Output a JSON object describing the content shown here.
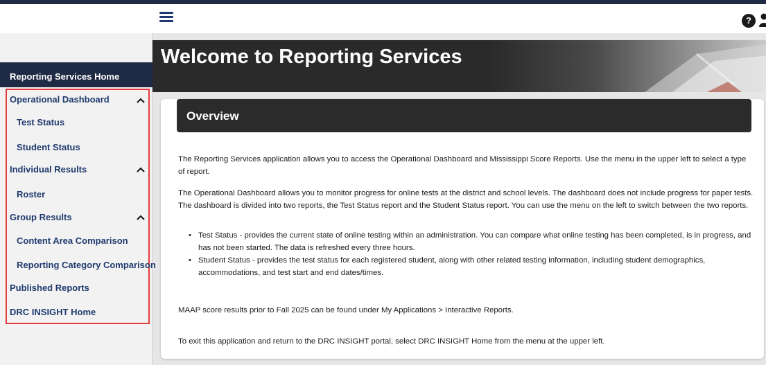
{
  "icons": {
    "menu": "hamburger-menu-icon",
    "help": "help-icon",
    "user": "user-icon",
    "chevron": "chevron-up-icon"
  },
  "header": {
    "help_glyph": "?"
  },
  "banner": {
    "title": "Welcome to Reporting Services"
  },
  "sidebar": {
    "home": "Reporting Services Home",
    "items": [
      {
        "label": "Operational Dashboard",
        "type": "group"
      },
      {
        "label": "Test Status",
        "type": "child"
      },
      {
        "label": "Student Status",
        "type": "child"
      },
      {
        "label": "Individual Results",
        "type": "group"
      },
      {
        "label": "Roster",
        "type": "child"
      },
      {
        "label": "Group Results",
        "type": "group"
      },
      {
        "label": "Content Area Comparison",
        "type": "child"
      },
      {
        "label": "Reporting Category Comparison",
        "type": "child"
      },
      {
        "label": "Published Reports",
        "type": "link"
      },
      {
        "label": "DRC INSIGHT Home",
        "type": "link"
      }
    ]
  },
  "overview": {
    "title": "Overview",
    "p1": "The Reporting Services application allows you to access the Operational Dashboard and Mississippi Score Reports. Use the menu in the upper left to select a type of report.",
    "p2": "The Operational Dashboard allows you to monitor progress for online tests at the district and school levels. The dashboard does not include progress for paper tests. The dashboard is divided into two reports, the Test Status report and the Student Status report. You can use the menu on the left to switch between the two reports.",
    "bullets": [
      "Test Status - provides the current state of online testing within an administration. You can compare what online testing has been completed, is in progress, and has not been started. The data is refreshed every three hours.",
      "Student Status - provides the test status for each registered student, along with other related testing information, including student demographics, accommodations, and test start and end dates/times."
    ],
    "p3": "MAAP score results prior to Fall 2025 can be found under My Applications > Interactive Reports.",
    "p4": "To exit this application and return to the DRC INSIGHT portal, select DRC INSIGHT Home from the menu at the upper left."
  },
  "colors": {
    "nav_text": "#1f3a6e",
    "header_dark": "#1f2a44",
    "highlight_border": "#e23b3b"
  }
}
